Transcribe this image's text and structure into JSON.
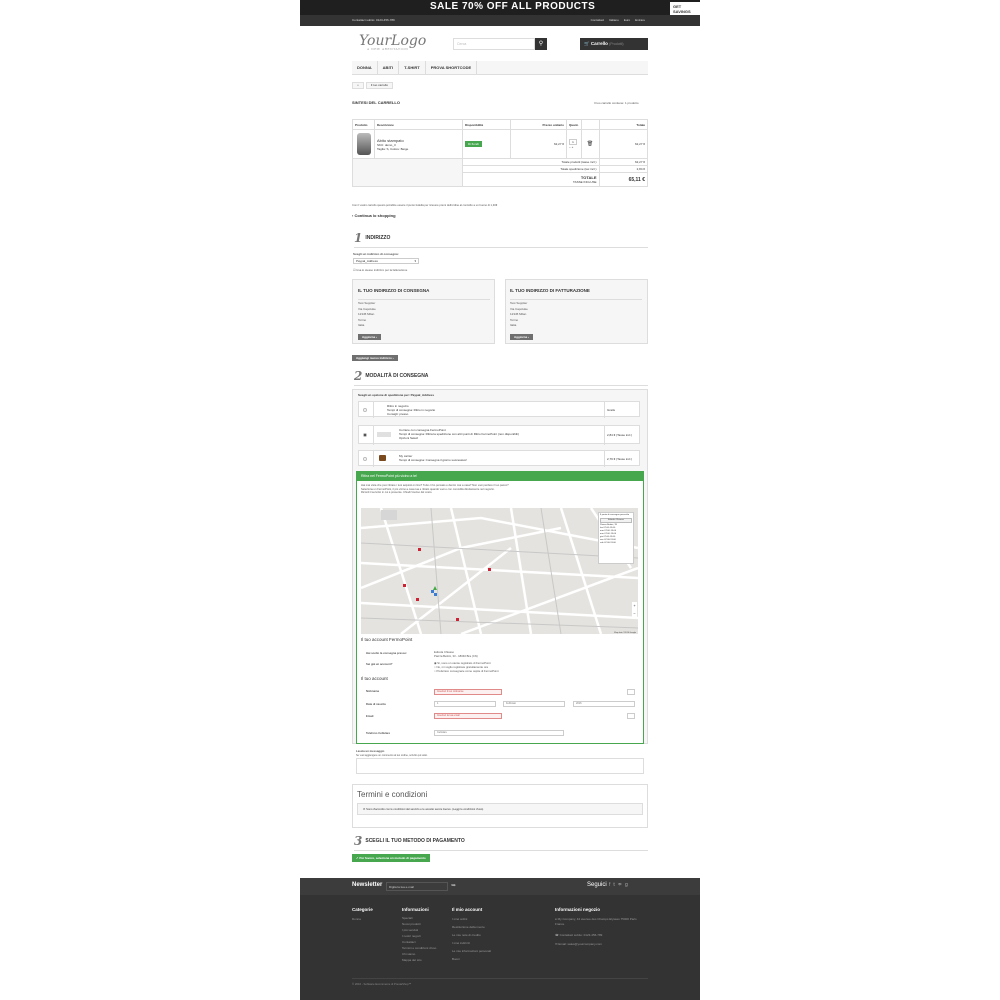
{
  "banner": {
    "text": "SALE 70% OFF ALL PRODUCTS",
    "button": "GET SAVINGS NOW"
  },
  "topnav": {
    "contact": "Contattaci subito: 0123-456-789",
    "links": [
      "Contattaci",
      "Italiano",
      "Euro",
      "Entrare"
    ]
  },
  "header": {
    "logo": "YourLogo",
    "tagline": "A NEW ARENTATION",
    "search_placeholder": "Cerca",
    "search_icon": "magnifier",
    "cart_label": "Carrello",
    "cart_sub": "(Prodotti)"
  },
  "menu": [
    "DONNA",
    "ABITI",
    "T-SHIRT",
    "PROVA SHORTCODE"
  ],
  "breadcrumb": {
    "home_icon": "home",
    "current": "Il tuo carrello"
  },
  "summary": {
    "title": "SINTESI DEL CARRELLO",
    "count": "Il tuo carrello contiene: 1 prodotto"
  },
  "cart": {
    "headers": [
      "Prodotto",
      "Descrizione",
      "Disponibilità",
      "Prezzo unitario",
      "Quant.",
      "",
      "Totale"
    ],
    "item": {
      "name": "Abito stampato",
      "ref": "SKU: demo_3",
      "attrs": "Taglia: S, Colore: Beige",
      "stock": "Di fiondi",
      "unit": "62,27 €",
      "qty": "1",
      "total": "62,27 €"
    },
    "totals": [
      {
        "label": "Totale prodotti (tasse incl.)",
        "value": "62,27 €"
      },
      {
        "label": "Totale spedizione (tax incl.)",
        "value": "2,84 €"
      }
    ],
    "grand_label": "TOTALE",
    "grand_sub": "TASSE INCLUSE",
    "grand_value": "65,11 €"
  },
  "note": "Con il vostro carrello questo potrebbe essere il punto fedeltà per ricevere premi dell'ordine al controllo a un buono di 1,30€",
  "continue": "Continua lo shopping",
  "step1": {
    "num": "1",
    "title": "INDIRIZZO",
    "choose": "Scegli un indirizzo di consegna:",
    "select": "Paypal_Address",
    "checkbox": "Usa lo stesso indirizzo per la fatturazione",
    "ship_title": "IL TUO INDIRIZZO DI CONSEGNA",
    "bill_title": "IL TUO INDIRIZZO DI FATTURAZIONE",
    "address": [
      "Test Supplier",
      "Via Capoluke",
      "12345 Milan",
      "Torino",
      "Italia"
    ],
    "update": "Aggiorna",
    "add_new": "Aggiungi nuovo indirizzo"
  },
  "step2": {
    "num": "2",
    "title": "MODALITÀ DI CONSEGNA",
    "choose": "Scegli un opzione di spedizione per: Paypal_Address",
    "carriers": [
      {
        "name": "Ritiro in negozio",
        "desc": "Tempi di consegna: Ritiro in negozio",
        "extra": "Consigli: presso",
        "price": "Gratis"
      },
      {
        "name": "Corriere con consegna FermoPoint",
        "desc": "Tempi di consegna: Ritira la spedizione con altri punti di Ritiro FermoPoint (non disponibili)",
        "extra": "Opzioni Selezi",
        "price": "2,84 € (Tasse incl.)"
      },
      {
        "name": "My carrier",
        "desc": "Tempi di consegna: Consegna il giorno successivo!",
        "extra": "",
        "price": "2,79 € (Tasse incl.)"
      }
    ],
    "fp_header": "Ritira nel FermoPoint più vicino a te!",
    "fp_text": [
      "Hai mai vista che puoi ritirare i tuoi acquisti on line? Tutto ci ho pensato e dentro mai a casa? Non vuoi perdere il tuo pacco?",
      "Seleziona un FermoPoint, il più vicino a casa tua e ritiralo quando vuoi e con comodità direttamente nel negozio.",
      "Ricordi il servizio in cui è presente. Chiudi! Avviso del costo."
    ],
    "map_info": {
      "heading": "Il punto di consegna prescelto",
      "point": "Edicola Chiasso",
      "addr": "Piazza Bettini, 33",
      "hours": [
        "lun 07:00-13:00",
        "mar 07:00-13:00",
        "mer 07:00-13:00",
        "gio 07:00-13:00",
        "ven 07:00-13:00",
        "sab 07:00-13:00"
      ]
    },
    "map_credit": "Map data ©2016 Google",
    "account_title": "Il tuo account FermoPoint",
    "consegna_label": "Hai scelto la consegna presso:",
    "consegna_value": "Edicola Chiasso",
    "consegna_addr": "Piazza Bettini, 33 - 18040 Bra (CN)",
    "registered_label": "Sei già un account?",
    "options": [
      "Sì, sono un utente registrato di FermoPoint",
      "No, mi voglio registrare gratuitamente ora",
      "Preferisco consegnare come ospite di FermoPoint"
    ],
    "your_account": "Il tuo account",
    "fields": [
      {
        "label": "Nickname",
        "value": "Inserisci il tuo nickname"
      },
      {
        "label": "Data di nascita",
        "value": "1"
      },
      {
        "label": "Email",
        "value": "Inserisci la tua email"
      },
      {
        "label": "Telefono Cellulare",
        "value": "Cellulare"
      }
    ],
    "month": "Febbraio",
    "year": "2016",
    "message_label": "Lascia un messaggio",
    "message_hint": "Se vuoi aggiungere un commento al tuo ordine, scrivilo qui sotto."
  },
  "terms": {
    "title": "Termini e condizioni",
    "text": "Sono d'accordo con le condizioni del servizio e le accetto senza riserve. (Leggi le condizioni d'uso)"
  },
  "step3": {
    "num": "3",
    "title": "SCEGLI IL TUO METODO DI PAGAMENTO",
    "button": "Per favore, seleziona un metodo di pagamento"
  },
  "footer": {
    "newsletter": "Newsletter",
    "newsletter_placeholder": "Digita la tua e-mail",
    "follow": "Seguici",
    "cols": [
      {
        "h": "Categorie",
        "items": [
          "Donna"
        ]
      },
      {
        "h": "Informazioni",
        "items": [
          "Speciali",
          "Nuovi prodotti",
          "I più venduti",
          "I nostri negozi",
          "Contattaci",
          "Termini e condizioni d'uso",
          "Chi siamo",
          "Mappa del sito"
        ]
      },
      {
        "h": "Il mio account",
        "items": [
          "I miei ordini",
          "Restituzione della merce",
          "Le mie note di credito",
          "I miei indirizzi",
          "Le mie informazioni personali",
          "Buoni"
        ]
      },
      {
        "h": "Informazioni negozio",
        "items": [
          "My Company, 42 avenue des Champs Elysées 75000 Paris France",
          "Contattaci subito: 0123-456-789",
          "Email: sales@yourcompany.com"
        ]
      }
    ],
    "copyright": "© 2016 - Software Ecommerce di PrestaShop™"
  }
}
